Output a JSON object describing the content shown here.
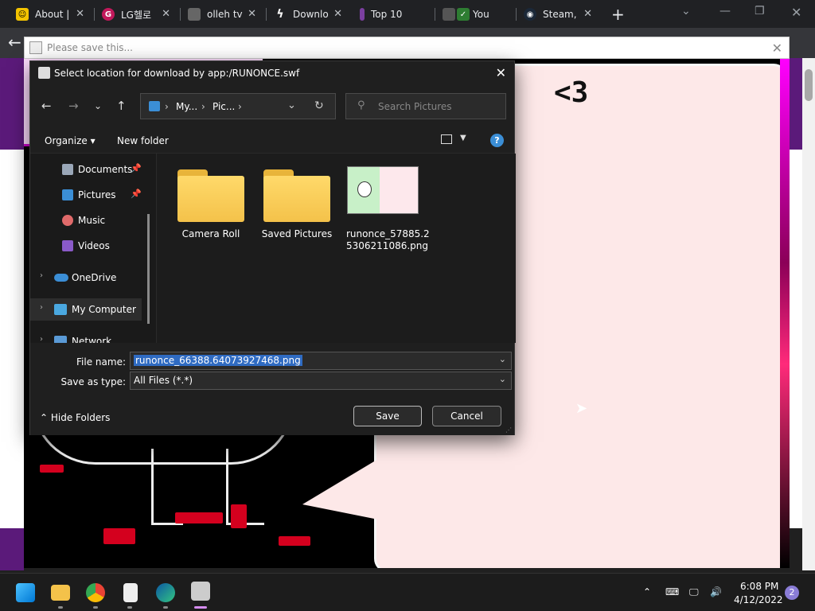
{
  "browser": {
    "tabs": [
      {
        "label": "About |",
        "icon": "smiley-icon",
        "color": "#f3c300"
      },
      {
        "label": "LG헬로",
        "icon": "lg-icon",
        "color": "#c2185b"
      },
      {
        "label": "olleh tv",
        "icon": "olleh-icon",
        "color": "#666666"
      },
      {
        "label": "Downlo",
        "icon": "bolt-icon",
        "color": "#ffffff"
      },
      {
        "label": "Top 10",
        "icon": "bookmark-icon",
        "color": "#7b3fa0"
      },
      {
        "label": "You",
        "icon": "check-icon",
        "color": "#2e7d32"
      },
      {
        "label": "Steam,",
        "icon": "steam-icon",
        "color": "#1b2838"
      }
    ],
    "tab_close": "✕",
    "new_tab": "+",
    "notification": {
      "text": "Please save this...",
      "close": "✕"
    }
  },
  "flash": {
    "heart_text": "<3"
  },
  "dialog": {
    "title": "Select location for download by app:/RUNONCE.swf",
    "close": "✕",
    "breadcrumb": [
      "My...",
      "Pic..."
    ],
    "search_placeholder": "Search Pictures",
    "organize_label": "Organize ▾",
    "new_folder_label": "New folder",
    "help": "?",
    "nav_items": [
      {
        "label": "Documents",
        "icon": "documents-icon",
        "pinned": true
      },
      {
        "label": "Pictures",
        "icon": "pictures-icon",
        "pinned": true
      },
      {
        "label": "Music",
        "icon": "music-icon",
        "pinned": false
      },
      {
        "label": "Videos",
        "icon": "videos-icon",
        "pinned": false
      },
      {
        "label": "OneDrive",
        "icon": "onedrive-icon",
        "pinned": false
      },
      {
        "label": "My Computer",
        "icon": "computer-icon",
        "pinned": false
      },
      {
        "label": "Network",
        "icon": "network-icon",
        "pinned": false
      }
    ],
    "files": [
      {
        "name": "Camera Roll",
        "type": "folder"
      },
      {
        "name": "Saved Pictures",
        "type": "folder"
      },
      {
        "name": "runonce_57885.2 5306211086.png",
        "type": "image"
      }
    ],
    "file_name_label": "File name:",
    "file_name_value": "runonce_66388.64073927468.png",
    "save_as_type_label": "Save as type:",
    "save_as_type_value": "All Files (*.*)",
    "hide_folders_label": "Hide Folders",
    "save_label": "Save",
    "cancel_label": "Cancel"
  },
  "taskbar": {
    "apps": [
      "start-icon",
      "file-explorer-icon",
      "chrome-icon",
      "flash-app-icon",
      "edge-icon",
      "runonce-app-icon"
    ],
    "time": "6:08 PM",
    "date": "4/12/2022",
    "notification_count": "2"
  },
  "colors": {
    "accent": "#3b8ed6",
    "selection": "#2f6bc2",
    "flash_pink": "#fde8e8",
    "flash_magenta": "#d000d0"
  }
}
